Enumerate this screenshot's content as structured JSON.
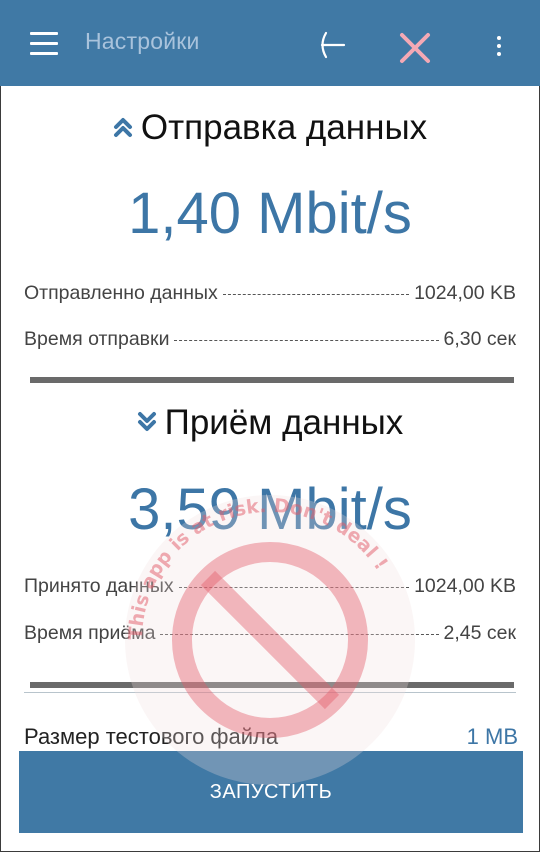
{
  "appbar": {
    "title": "Настройки",
    "icons": [
      "menu-icon",
      "back-arrow-icon",
      "close-icon",
      "more-vert-icon"
    ],
    "close_icon_color": "#f4a9b5"
  },
  "upload": {
    "title": "Отправка данных",
    "speed": "1,40 Mbit/s",
    "rows": [
      {
        "label": "Отправленно данных",
        "value": "1024,00 KB"
      },
      {
        "label": "Время отправки",
        "value": "6,30 сек"
      }
    ]
  },
  "download": {
    "title": "Приём данных",
    "speed": "3,59 Mbit/s",
    "rows": [
      {
        "label": "Принято данных",
        "value": "1024,00 KB"
      },
      {
        "label": "Время приёма",
        "value": "2,45 сек"
      }
    ]
  },
  "settings": {
    "file_size_label": "Размер тестового файла",
    "file_size_value": "1 MB"
  },
  "actions": {
    "run_label": "ЗАПУСТИТЬ"
  },
  "watermark": {
    "text": "This app is at risk. Don't deal !"
  },
  "colors": {
    "accent": "#4079a5",
    "speed_text": "#3d76a6"
  }
}
